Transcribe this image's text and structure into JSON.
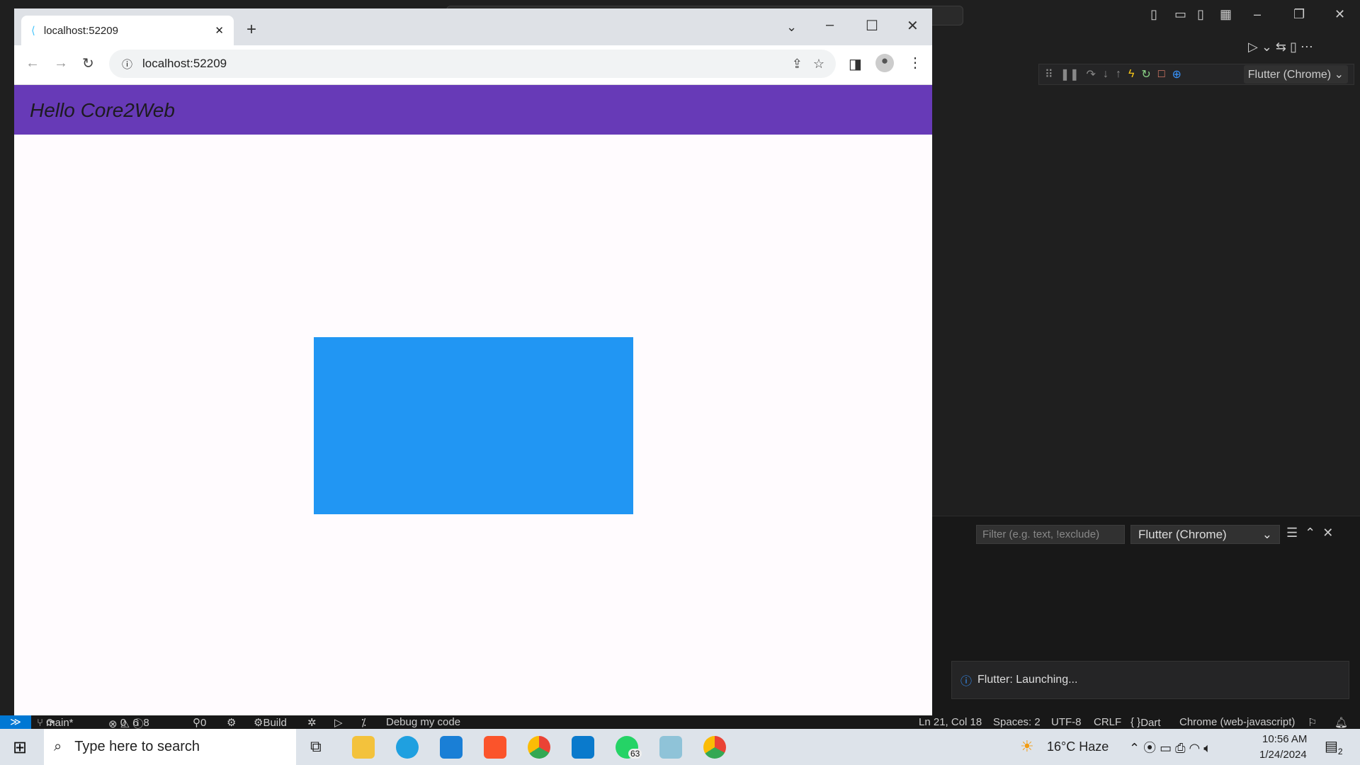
{
  "browser": {
    "tab_title": "localhost:52209",
    "url": "localhost:52209",
    "app_title": "Hello Core2Web",
    "box_color": "#2196f3",
    "appbar_color": "#673ab7"
  },
  "vscode": {
    "debug_target": "Flutter (Chrome)",
    "panel": {
      "filter_placeholder": "Filter (e.g. text, !exclude)",
      "select": "Flutter (Chrome)"
    },
    "notification": "Flutter: Launching...",
    "status": {
      "branch": "main*",
      "errors": "0",
      "warnings": "6",
      "infos": "8",
      "ports": "0",
      "build": "Build",
      "debug": "Debug my code",
      "position": "Ln 21, Col 18",
      "spaces": "Spaces: 2",
      "encoding": "UTF-8",
      "eol": "CRLF",
      "language": "Dart",
      "device": "Chrome (web-javascript)"
    }
  },
  "taskbar": {
    "search_placeholder": "Type here to search",
    "weather": "16°C  Haze",
    "time": "10:56 AM",
    "date": "1/24/2024",
    "whatsapp_badge": "63",
    "notif_count": "2"
  }
}
